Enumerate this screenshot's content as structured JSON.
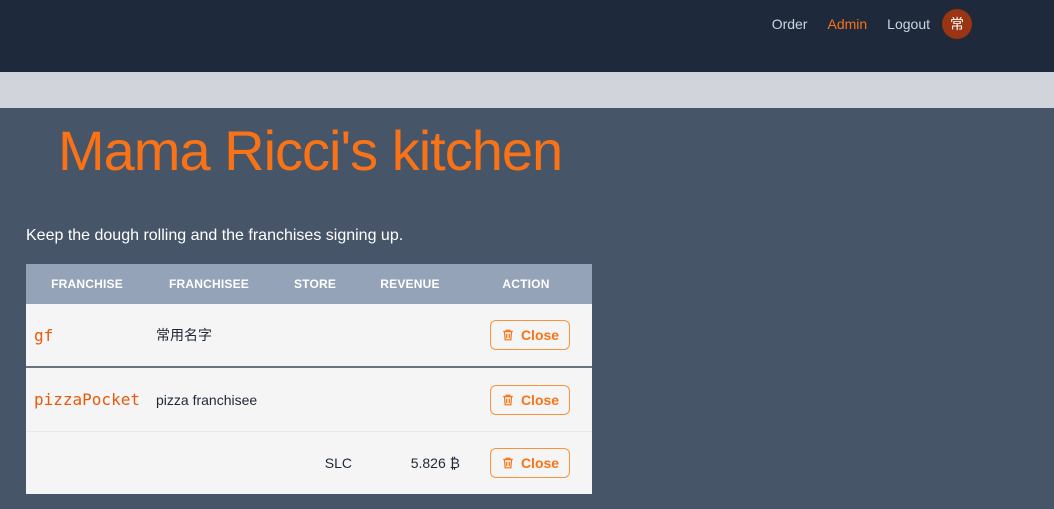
{
  "nav": {
    "items": [
      {
        "label": "Order",
        "active": false
      },
      {
        "label": "Admin",
        "active": true
      },
      {
        "label": "Logout",
        "active": false
      }
    ],
    "avatar_text": "常"
  },
  "page": {
    "title": "Mama Ricci's kitchen",
    "subtitle": "Keep the dough rolling and the franchises signing up."
  },
  "table": {
    "headers": [
      "Franchise",
      "Franchisee",
      "Store",
      "Revenue",
      "Action"
    ],
    "rows": [
      {
        "franchise": "gf",
        "franchisee": "常用名字",
        "store": "",
        "revenue": "",
        "action": "Close"
      },
      {
        "franchise": "pizzaPocket",
        "franchisee": "pizza franchisee",
        "store": "",
        "revenue": "",
        "action": "Close"
      },
      {
        "franchise": "",
        "franchisee": "",
        "store": "SLC",
        "revenue": "5.826 ₿",
        "action": "Close"
      }
    ]
  },
  "icons": {
    "close_action": "trash-icon"
  },
  "colors": {
    "accent": "#f97316",
    "header_bg": "#1e293b",
    "body_bg": "#475569",
    "table_head": "#94a3b8"
  }
}
